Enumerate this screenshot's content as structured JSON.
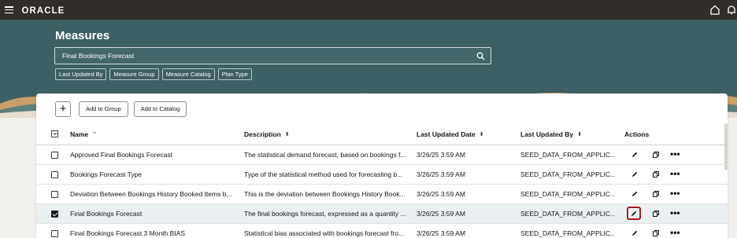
{
  "topbar": {
    "brand": "ORACLE"
  },
  "page": {
    "title": "Measures",
    "search_value": "Final Bookings Forecast",
    "filters": [
      "Last Updated By",
      "Measure Group",
      "Measure Catalog",
      "Plan Type"
    ]
  },
  "toolbar": {
    "add_icon": "plus-icon",
    "add_to_group": "Add to Group",
    "add_to_catalog": "Add to Catalog"
  },
  "table": {
    "columns": {
      "name": "Name",
      "name_sort": "⌃",
      "description": "Description",
      "date": "Last Updated Date",
      "by": "Last Updated By",
      "actions": "Actions",
      "sort_glyph": "⬍"
    },
    "rows": [
      {
        "name": "Approved Final Bookings Forecast",
        "description": "The statistical demand forecast, based on bookings f...",
        "date": "3/26/25 3:59 AM",
        "by": "SEED_DATA_FROM_APPLIC...",
        "checked": false
      },
      {
        "name": "Bookings Forecast Type",
        "description": "Type of the statistical method used for forecasting b...",
        "date": "3/26/25 3:59 AM",
        "by": "SEED_DATA_FROM_APPLIC...",
        "checked": false
      },
      {
        "name": "Deviation Between Bookings History Booked Items b...",
        "description": "This is the deviation between Bookings History Book...",
        "date": "3/26/25 3:59 AM",
        "by": "SEED_DATA_FROM_APPLIC...",
        "checked": false
      },
      {
        "name": "Final Bookings Forecast",
        "description": "The final bookings forecast, expressed as a quantity ...",
        "date": "3/26/25 3:59 AM",
        "by": "SEED_DATA_FROM_APPLIC...",
        "checked": true
      },
      {
        "name": "Final Bookings Forecast 3 Month BIAS",
        "description": "Statistical bias associated with bookings forecast fro...",
        "date": "3/26/25 3:59 AM",
        "by": "SEED_DATA_FROM_APPLIC...",
        "checked": false
      }
    ],
    "more_glyph": "•••"
  },
  "colors": {
    "topbar": "#312d2a",
    "hero": "#3e5f63",
    "focus_ring": "#9e1b24",
    "selected_row": "#eaf0f2"
  }
}
